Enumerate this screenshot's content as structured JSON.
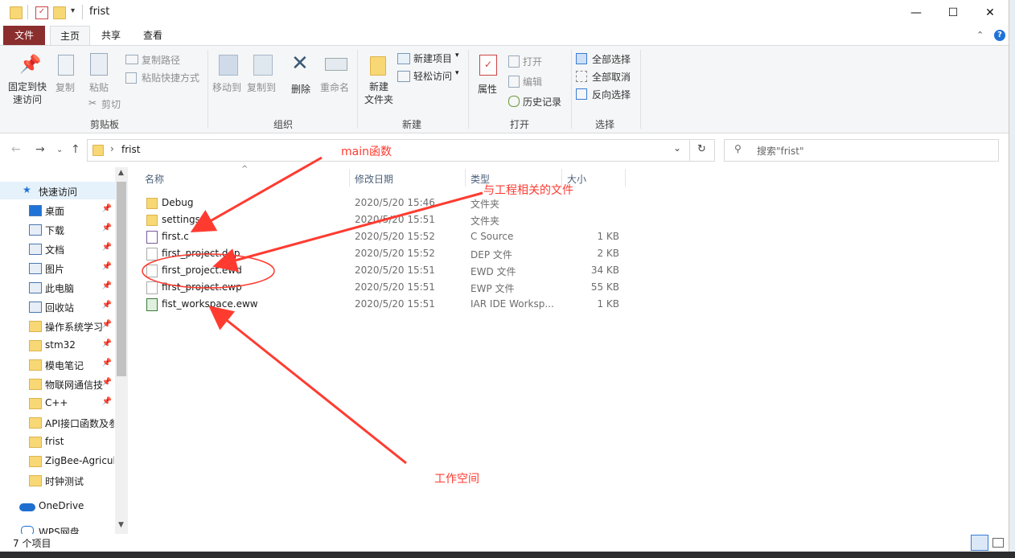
{
  "window": {
    "title": "frist",
    "controls": {
      "minimize": "—",
      "maximize": "☐",
      "close": "✕"
    }
  },
  "ribbon": {
    "tabs": [
      {
        "label": "文件"
      },
      {
        "label": "主页"
      },
      {
        "label": "共享"
      },
      {
        "label": "查看"
      }
    ],
    "clipboard": {
      "pin_label": "固定到快\n速访问",
      "copy_label": "复制",
      "paste_label": "粘贴",
      "copy_path": "复制路径",
      "paste_shortcut": "粘贴快捷方式",
      "cut": "剪切",
      "group": "剪贴板"
    },
    "organize": {
      "move_to": "移动到",
      "copy_to": "复制到",
      "delete": "删除",
      "rename": "重命名",
      "group": "组织"
    },
    "new": {
      "new_folder": "新建\n文件夹",
      "new_item": "新建项目",
      "easy_access": "轻松访问",
      "group": "新建"
    },
    "open": {
      "properties": "属性",
      "open": "打开",
      "edit": "编辑",
      "history": "历史记录",
      "group": "打开"
    },
    "select": {
      "select_all": "全部选择",
      "select_none": "全部取消",
      "invert": "反向选择",
      "group": "选择"
    }
  },
  "address": {
    "path": "frist",
    "search_placeholder": "搜索\"frist\""
  },
  "navpane": {
    "quick_access": "快速访问",
    "items": [
      {
        "label": "桌面",
        "pinned": true
      },
      {
        "label": "下载",
        "pinned": true
      },
      {
        "label": "文档",
        "pinned": true
      },
      {
        "label": "图片",
        "pinned": true
      },
      {
        "label": "此电脑",
        "pinned": true
      },
      {
        "label": "回收站",
        "pinned": true
      },
      {
        "label": "操作系统学习",
        "pinned": true
      },
      {
        "label": "stm32",
        "pinned": true
      },
      {
        "label": "模电笔记",
        "pinned": true
      },
      {
        "label": "物联网通信技",
        "pinned": true
      },
      {
        "label": "C++",
        "pinned": true
      },
      {
        "label": "API接口函数及参",
        "pinned": false
      },
      {
        "label": "frist",
        "pinned": false
      },
      {
        "label": "ZigBee-Agricul",
        "pinned": false
      },
      {
        "label": "时钟测试",
        "pinned": false
      }
    ],
    "onedrive": "OneDrive",
    "wps": "WPS网盘"
  },
  "filelist": {
    "headers": {
      "name": "名称",
      "date": "修改日期",
      "type": "类型",
      "size": "大小"
    },
    "rows": [
      {
        "name": "Debug",
        "date": "2020/5/20 15:46",
        "type": "文件夹",
        "size": "",
        "icon": "folder-icon"
      },
      {
        "name": "settings",
        "date": "2020/5/20 15:51",
        "type": "文件夹",
        "size": "",
        "icon": "folder-icon"
      },
      {
        "name": "first.c",
        "date": "2020/5/20 15:52",
        "type": "C Source",
        "size": "1 KB",
        "icon": "c-source-icon"
      },
      {
        "name": "first_project.dep",
        "date": "2020/5/20 15:52",
        "type": "DEP 文件",
        "size": "2 KB",
        "icon": "file-icon"
      },
      {
        "name": "first_project.ewd",
        "date": "2020/5/20 15:51",
        "type": "EWD 文件",
        "size": "34 KB",
        "icon": "file-icon"
      },
      {
        "name": "first_project.ewp",
        "date": "2020/5/20 15:51",
        "type": "EWP 文件",
        "size": "55 KB",
        "icon": "file-icon"
      },
      {
        "name": "fist_workspace.eww",
        "date": "2020/5/20 15:51",
        "type": "IAR IDE Worksp...",
        "size": "1 KB",
        "icon": "iar-workspace-icon"
      }
    ]
  },
  "annotations": {
    "main": "main函数",
    "project_files": "与工程相关的文件",
    "workspace": "工作空间"
  },
  "status": {
    "count": "7 个项目"
  },
  "colors": {
    "accent": "#0078d7",
    "file_tab": "#8a2e2e",
    "annotation": "#ff3b30",
    "folder": "#f8d775"
  }
}
